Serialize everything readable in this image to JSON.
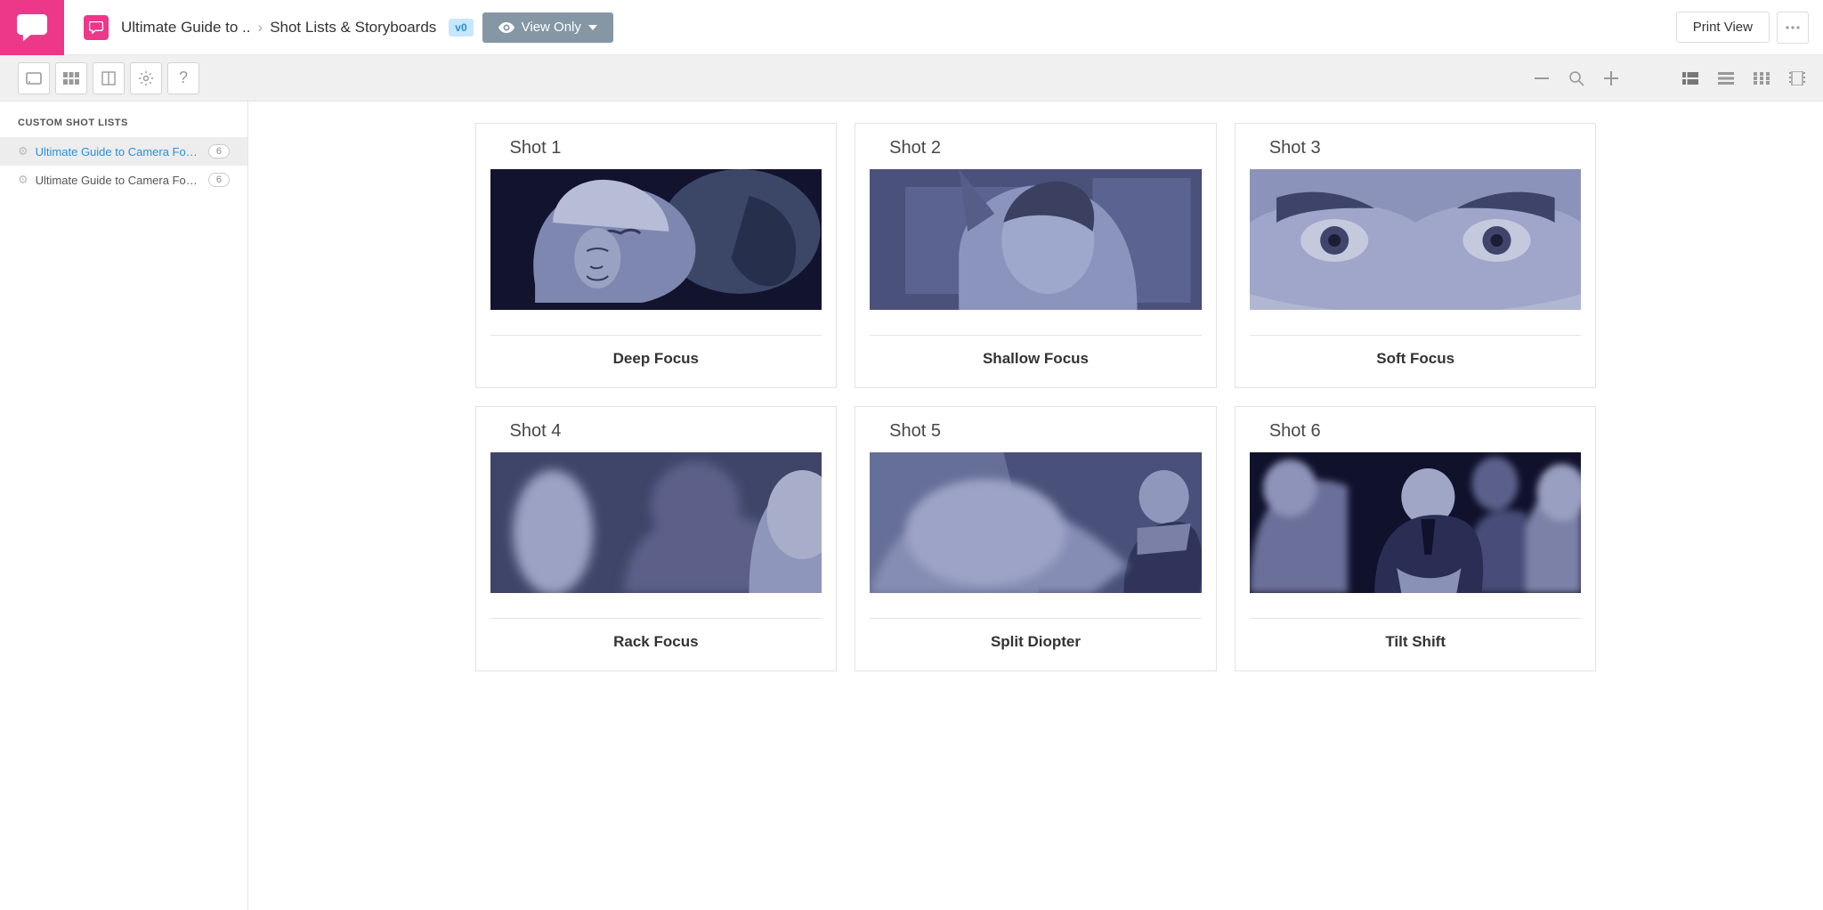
{
  "breadcrumb": {
    "project": "Ultimate Guide to ..",
    "page": "Shot Lists & Storyboards",
    "version_tag": "v0"
  },
  "header": {
    "view_only": "View Only",
    "print_view": "Print View"
  },
  "sidebar": {
    "title": "CUSTOM SHOT LISTS",
    "items": [
      {
        "label": "Ultimate Guide to Camera Focus i...",
        "count": "6",
        "active": true
      },
      {
        "label": "Ultimate Guide to Camera Focus in...",
        "count": "6",
        "active": false
      }
    ]
  },
  "shots": [
    {
      "title": "Shot 1",
      "caption": "Deep Focus"
    },
    {
      "title": "Shot 2",
      "caption": "Shallow Focus"
    },
    {
      "title": "Shot 3",
      "caption": "Soft Focus"
    },
    {
      "title": "Shot 4",
      "caption": "Rack Focus"
    },
    {
      "title": "Shot 5",
      "caption": "Split Diopter"
    },
    {
      "title": "Shot 6",
      "caption": "Tilt Shift"
    }
  ]
}
